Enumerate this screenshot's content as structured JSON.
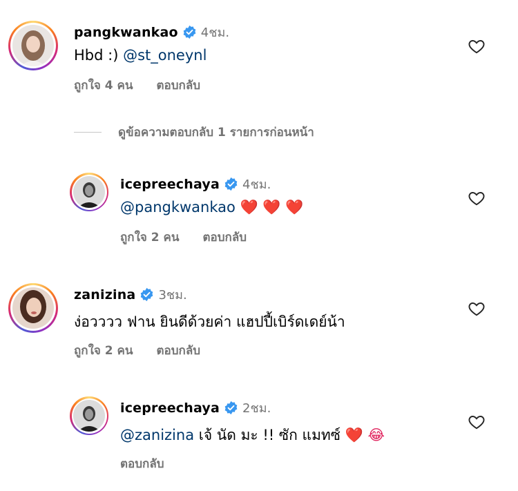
{
  "comments": [
    {
      "username": "pangkwankao",
      "time": "4ชม.",
      "text_parts": [
        "Hbd :) ",
        "@st_oneynl"
      ],
      "likes": "ถูกใจ 4 คน",
      "reply": "ตอบกลับ"
    },
    {
      "username": "icepreechaya",
      "time": "4ชม.",
      "mention": "@pangkwankao",
      "emoji": "❤️ ❤️ ❤️",
      "likes": "ถูกใจ 2 คน",
      "reply": "ตอบกลับ"
    },
    {
      "username": "zanizina",
      "time": "3ชม.",
      "text": "ง่อวววว ฟาน ยินดีด้วยค่า แฮปปี้เบิร์ดเดย์น้า",
      "likes": "ถูกใจ 2 คน",
      "reply": "ตอบกลับ"
    },
    {
      "username": "icepreechaya",
      "time": "2ชม.",
      "mention": "@zanizina",
      "text": " เจ้ นัด มะ !! ซัก แมทซ์ ",
      "emoji": "❤️ 😂",
      "reply": "ตอบกลับ"
    }
  ],
  "view_previous_replies": "ดูข้อความตอบกลับ 1 รายการก่อนหน้า",
  "colors": {
    "link": "#00376b",
    "muted": "#737373",
    "verified": "#3897f0"
  }
}
